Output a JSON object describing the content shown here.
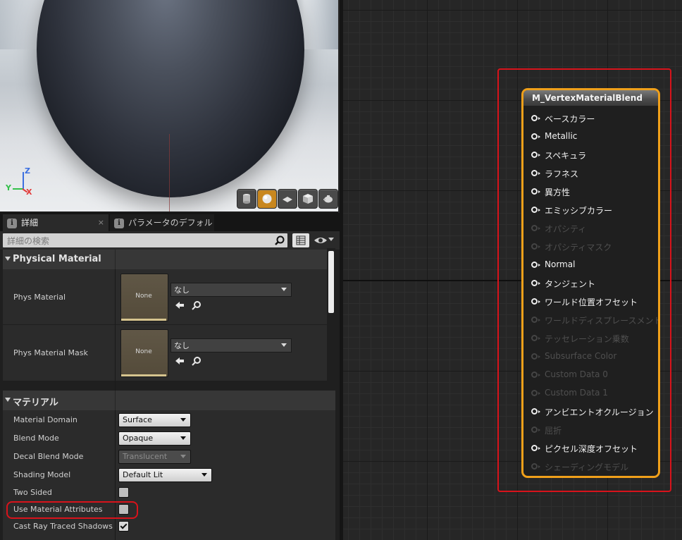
{
  "viewport": {
    "axis_z": "Z",
    "axis_y": "Y",
    "axis_x": "X",
    "toolbar_buttons": [
      {
        "name": "cylinder-preview",
        "active": false
      },
      {
        "name": "sphere-preview",
        "active": true
      },
      {
        "name": "plane-preview",
        "active": false
      },
      {
        "name": "cube-preview",
        "active": false
      },
      {
        "name": "custom-mesh-preview",
        "active": false
      }
    ]
  },
  "details": {
    "tabs": [
      {
        "label": "詳細",
        "close": "×"
      },
      {
        "label": "パラメータのデフォル"
      }
    ],
    "search_placeholder": "詳細の検索",
    "categories": {
      "physical": "Physical Material",
      "material": "マテリアル"
    },
    "physical_props": [
      {
        "label": "Phys Material",
        "thumb": "None",
        "value": "なし"
      },
      {
        "label": "Phys Material Mask",
        "thumb": "None",
        "value": "なし"
      }
    ],
    "material_props": {
      "domain": {
        "label": "Material Domain",
        "value": "Surface"
      },
      "blend": {
        "label": "Blend Mode",
        "value": "Opaque"
      },
      "decal": {
        "label": "Decal Blend Mode",
        "value": "Translucent"
      },
      "shading": {
        "label": "Shading Model",
        "value": "Default Lit"
      },
      "two_sided": {
        "label": "Two Sided",
        "checked": false
      },
      "use_attrs": {
        "label": "Use Material Attributes",
        "checked": false
      },
      "cast_shadows": {
        "label": "Cast Ray Traced Shadows",
        "checked": true
      }
    }
  },
  "node": {
    "title": "M_VertexMaterialBlend",
    "pins": [
      {
        "label": "ベースカラー",
        "enabled": true
      },
      {
        "label": "Metallic",
        "enabled": true
      },
      {
        "label": "スペキュラ",
        "enabled": true
      },
      {
        "label": "ラフネス",
        "enabled": true
      },
      {
        "label": "異方性",
        "enabled": true
      },
      {
        "label": "エミッシブカラー",
        "enabled": true
      },
      {
        "label": "オパシティ",
        "enabled": false
      },
      {
        "label": "オパシティマスク",
        "enabled": false
      },
      {
        "label": "Normal",
        "enabled": true
      },
      {
        "label": "タンジェント",
        "enabled": true
      },
      {
        "label": "ワールド位置オフセット",
        "enabled": true
      },
      {
        "label": "ワールドディスプレースメント",
        "enabled": false
      },
      {
        "label": "テッセレーション乗数",
        "enabled": false
      },
      {
        "label": "Subsurface Color",
        "enabled": false
      },
      {
        "label": "Custom Data 0",
        "enabled": false
      },
      {
        "label": "Custom Data 1",
        "enabled": false
      },
      {
        "label": "アンビエントオクルージョン",
        "enabled": true
      },
      {
        "label": "屈折",
        "enabled": false
      },
      {
        "label": "ピクセル深度オフセット",
        "enabled": true
      },
      {
        "label": "シェーディングモデル",
        "enabled": false
      }
    ]
  },
  "colors": {
    "highlight_red": "#d8131b",
    "node_border": "#f0a01a",
    "active_button": "#c8871f"
  }
}
